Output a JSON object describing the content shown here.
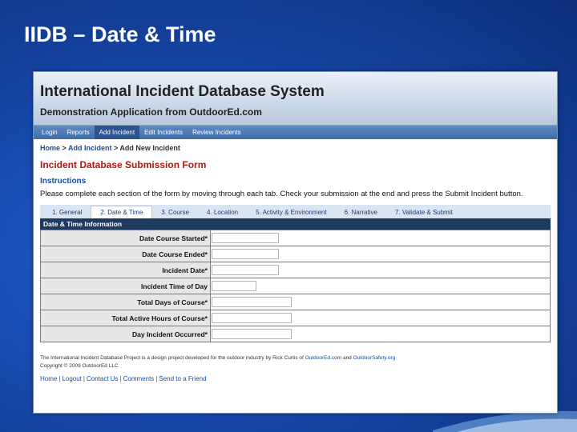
{
  "slide": {
    "title": "IIDB – Date & Time"
  },
  "app": {
    "title": "International Incident Database System",
    "subtitle": "Demonstration Application from OutdoorEd.com"
  },
  "nav": {
    "items": [
      "Login",
      "Reports",
      "Add Incident",
      "Edit Incidents",
      "Review Incidents"
    ],
    "active": "Add Incident"
  },
  "breadcrumb": {
    "home": "Home",
    "add_incident": "Add Incident",
    "current": "Add New Incident"
  },
  "form": {
    "title": "Incident Database Submission Form",
    "instructions_heading": "Instructions",
    "instructions_text": "Please complete each section of the form by moving through each tab. Check your submission at the end and press the Submit Incident button."
  },
  "tabs": [
    "1. General",
    "2. Date & Time",
    "3. Course",
    "4. Location",
    "5. Activity & Environment",
    "6. Narrative",
    "7. Validate & Submit"
  ],
  "active_tab": "2. Date & Time",
  "section": {
    "header": "Date & Time Information"
  },
  "fields": [
    {
      "label": "Date Course Started*",
      "value": ""
    },
    {
      "label": "Date Course Ended*",
      "value": ""
    },
    {
      "label": "Incident Date*",
      "value": ""
    },
    {
      "label": "Incident Time of Day",
      "value": ""
    },
    {
      "label": "Total Days of Course*",
      "value": ""
    },
    {
      "label": "Total Active Hours of Course*",
      "value": ""
    },
    {
      "label": "Day Incident Occurred*",
      "value": ""
    }
  ],
  "footer": {
    "line1_prefix": "The International Incident Database Project is a design project developed for the outdoor industry by Rick Curtis of",
    "link1": "OutdoorEd.com",
    "line1_and": "and",
    "link2": "OutdoorSafety.org",
    "copyright": "Copyright © 2009 OutdoorEd LLC",
    "links": [
      "Home",
      "Logout",
      "Contact Us",
      "Comments",
      "Send to a Friend"
    ]
  },
  "colors": {
    "slide_background": "#1647a8",
    "nav_bar": "#4a78b5",
    "form_title": "#b01818",
    "panel_header": "#1e3a5f",
    "link": "#1a4fa0"
  }
}
